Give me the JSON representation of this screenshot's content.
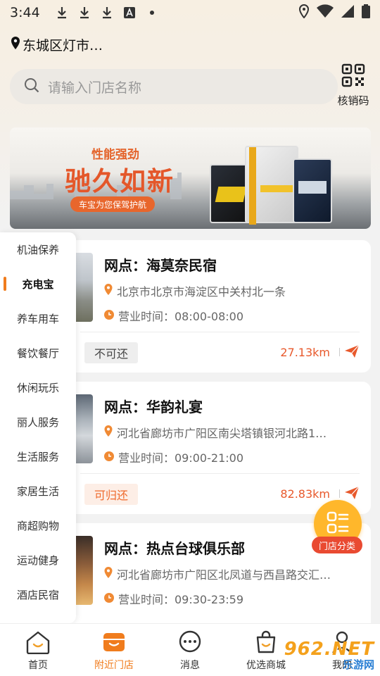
{
  "status_bar": {
    "time": "3:44"
  },
  "location": {
    "text": "东城区灯市…"
  },
  "search": {
    "placeholder": "请输入门店名称"
  },
  "scan": {
    "label": "核销码"
  },
  "banner": {
    "slogan_small": "性能强劲",
    "slogan_big": "驰久如新",
    "pill": "车宝为您保驾护航"
  },
  "categories": [
    {
      "label": "机油保养"
    },
    {
      "label": "充电宝",
      "active": true
    },
    {
      "label": "养车用车"
    },
    {
      "label": "餐饮餐厅"
    },
    {
      "label": "休闲玩乐"
    },
    {
      "label": "丽人服务"
    },
    {
      "label": "生活服务"
    },
    {
      "label": "家居生活"
    },
    {
      "label": "商超购物"
    },
    {
      "label": "运动健身"
    },
    {
      "label": "酒店民宿"
    }
  ],
  "stores": [
    {
      "title": "网点：海莫奈民宿",
      "address": "北京市北京市海淀区中关村北一条",
      "hours": "营业时间：08:00-08:00",
      "badge": "不可还",
      "distance": "27.13km"
    },
    {
      "title": "网点：华韵礼宴",
      "address": "河北省廊坊市广阳区南尖塔镇银河北路1…",
      "hours": "营业时间：09:00-21:00",
      "badge": "可归还",
      "distance": "82.83km"
    },
    {
      "title": "网点：热点台球俱乐部",
      "address": "河北省廊坊市广阳区北凤道与西昌路交汇…",
      "hours": "营业时间：09:30-23:59",
      "badge": "",
      "distance": ""
    }
  ],
  "float_button": {
    "label": "门店分类"
  },
  "tabs": [
    {
      "label": "首页",
      "icon": "home-icon"
    },
    {
      "label": "附近门店",
      "icon": "store-icon",
      "active": true
    },
    {
      "label": "消息",
      "icon": "message-icon"
    },
    {
      "label": "优选商城",
      "icon": "shopping-bag-icon"
    },
    {
      "label": "我的",
      "icon": "profile-icon"
    }
  ],
  "watermark": {
    "logo": "962.NET",
    "text": "乐游网"
  },
  "colors": {
    "accent": "#f07c1d",
    "distance": "#e8592c",
    "float": "#ffb72b"
  }
}
